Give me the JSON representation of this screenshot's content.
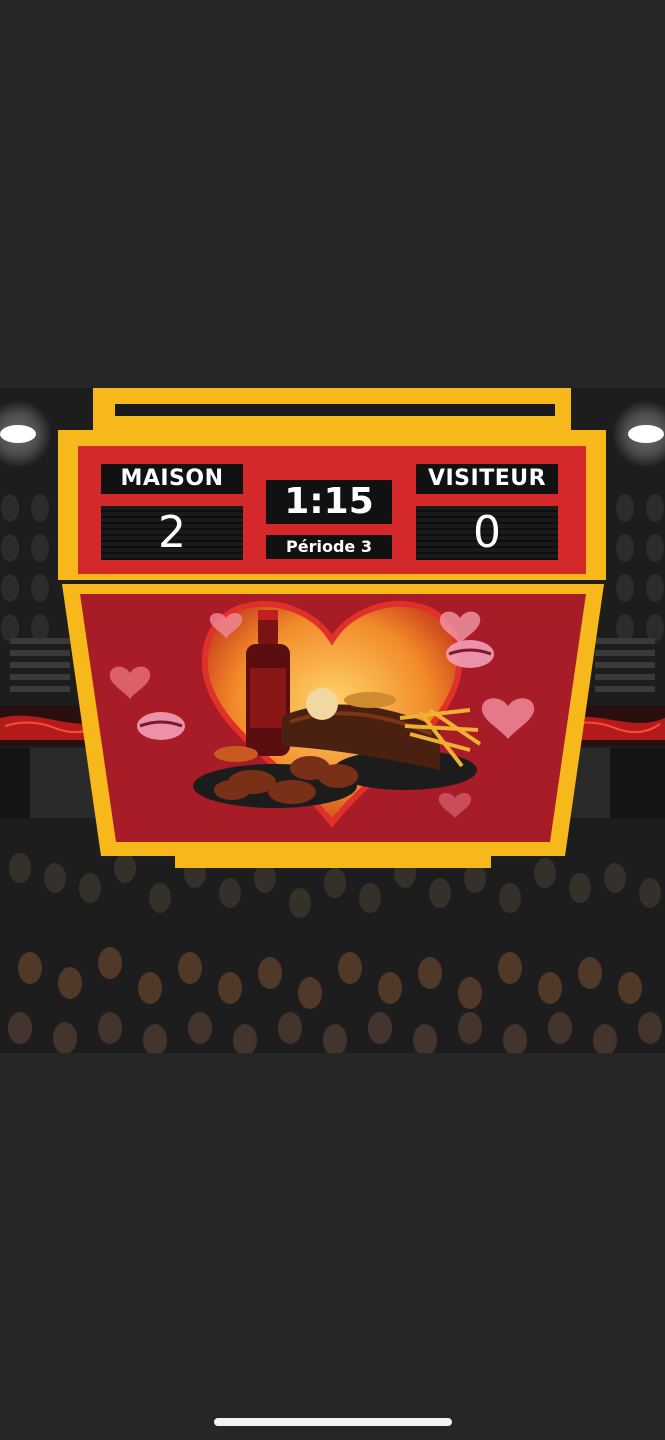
{
  "scoreboard": {
    "home_label": "MAISON",
    "home_score": "2",
    "away_label": "VISITEUR",
    "away_score": "0",
    "clock": "1:15",
    "period": "Période 3"
  },
  "icons": [
    "spotlight-icon",
    "heart-icon",
    "lips-kiss-icon"
  ],
  "colors": {
    "background": "#262626",
    "frame_yellow": "#f7b81c",
    "board_red": "#d5282a",
    "panel_red": "#a81c28"
  }
}
